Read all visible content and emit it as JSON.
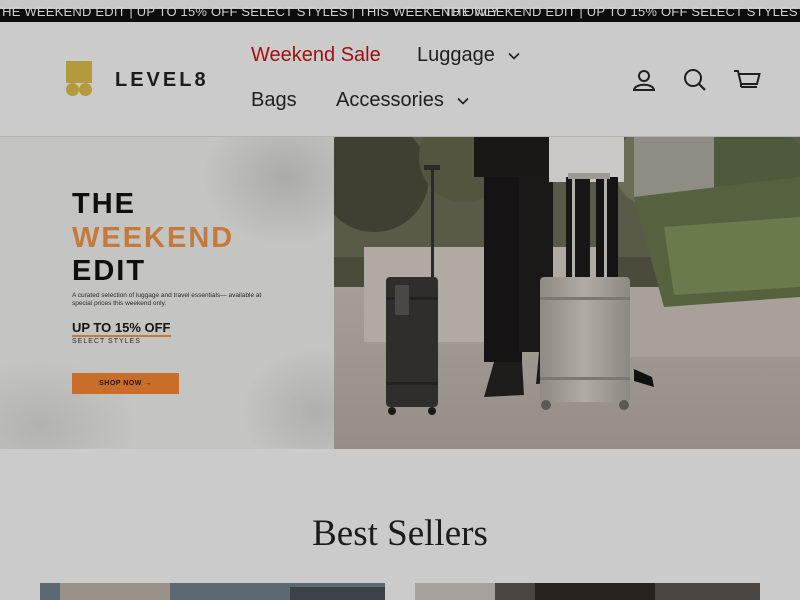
{
  "announcement": {
    "text": "THE WEEKEND EDIT | UP TO 15% OFF SELECT STYLES | THIS WEEKEND ONLY"
  },
  "header": {
    "logo_text": "LEVEL8",
    "nav": {
      "weekend_sale": "Weekend Sale",
      "luggage": "Luggage",
      "bags": "Bags",
      "accessories": "Accessories"
    },
    "icons": {
      "account": "account-icon",
      "search": "search-icon",
      "cart": "cart-icon",
      "chevron": "chevron-down-icon"
    }
  },
  "hero": {
    "line1": "THE",
    "line2": "WEEKEND",
    "line3": "EDIT",
    "subtext": "A curated selection of luggage and travel essentials— available at special prices this weekend only.",
    "offer": "UP TO 15% OFF",
    "styles": "SELECT STYLES",
    "cta": "SHOP NOW →"
  },
  "sections": {
    "best_sellers_title": "Best Sellers"
  },
  "colors": {
    "sale_red": "#a11010",
    "brand_gold": "#b39a3d",
    "accent_orange": "#c96d2a",
    "weekend_orange": "#c57a3a"
  }
}
